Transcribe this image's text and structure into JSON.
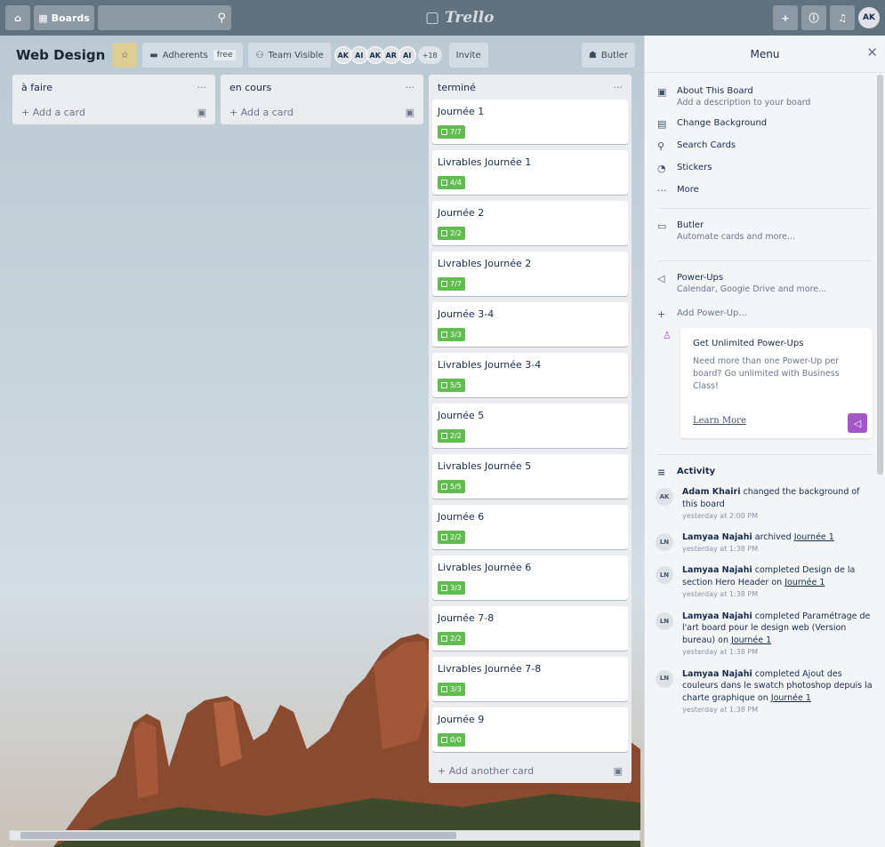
{
  "nav": {
    "boards_label": "Boards",
    "logo": "Trello",
    "avatar": "AK"
  },
  "board": {
    "title": "Web Design",
    "adherents_label": "Adherents",
    "adherents_tag": "free",
    "visibility_label": "Team Visible",
    "members": [
      "AK",
      "AI",
      "AK",
      "AR",
      "AI"
    ],
    "members_more": "+18",
    "invite_label": "Invite",
    "butler_label": "Butler"
  },
  "lists": [
    {
      "title": "à faire",
      "add_label": "+ Add a card",
      "cards": []
    },
    {
      "title": "en cours",
      "add_label": "+ Add a card",
      "cards": []
    },
    {
      "title": "terminé",
      "add_label": "+ Add another card",
      "cards": [
        {
          "title": "Journée 1",
          "badge": "7/7"
        },
        {
          "title": "Livrables Journée 1",
          "badge": "4/4"
        },
        {
          "title": "Journée 2",
          "badge": "2/2"
        },
        {
          "title": "Livrables Journée 2",
          "badge": "7/7"
        },
        {
          "title": "Journée 3-4",
          "badge": "3/3"
        },
        {
          "title": "Livrables Journée 3-4",
          "badge": "5/5"
        },
        {
          "title": "Journée 5",
          "badge": "2/2"
        },
        {
          "title": "Livrables Journée 5",
          "badge": "5/5"
        },
        {
          "title": "Journée 6",
          "badge": "2/2"
        },
        {
          "title": "Livrables Journée 6",
          "badge": "3/3"
        },
        {
          "title": "Journée 7-8",
          "badge": "2/2"
        },
        {
          "title": "Livrables Journée 7-8",
          "badge": "3/3"
        },
        {
          "title": "Journée 9",
          "badge": "0/0"
        }
      ]
    }
  ],
  "menu": {
    "title": "Menu",
    "about_title": "About This Board",
    "about_sub": "Add a description to your board",
    "change_bg": "Change Background",
    "search_cards": "Search Cards",
    "stickers": "Stickers",
    "more": "More",
    "butler_title": "Butler",
    "butler_sub": "Automate cards and more...",
    "powerups_title": "Power-Ups",
    "powerups_sub": "Calendar, Google Drive and more...",
    "add_powerup": "Add Power-Up...",
    "unlimited_title": "Get Unlimited Power-Ups",
    "unlimited_text": "Need more than one Power-Up per board? Go unlimited with Business Class!",
    "learn_more": "Learn More",
    "activity_title": "Activity",
    "activity": [
      {
        "avatar": "AK",
        "user": "Adam Khairi",
        "text": " changed the background of this board",
        "link": "",
        "time": "yesterday at 2:00 PM"
      },
      {
        "avatar": "LN",
        "user": "Lamyaa Najahi",
        "text": " archived ",
        "link": "Journée 1",
        "time": "yesterday at 1:38 PM"
      },
      {
        "avatar": "LN",
        "user": "Lamyaa Najahi",
        "text": " completed Design de la section Hero Header on ",
        "link": "Journée 1",
        "time": "yesterday at 1:38 PM"
      },
      {
        "avatar": "LN",
        "user": "Lamyaa Najahi",
        "text": " completed Paramétrage de l'art board pour le design web (Version bureau) on ",
        "link": "Journée 1",
        "time": "yesterday at 1:38 PM"
      },
      {
        "avatar": "LN",
        "user": "Lamyaa Najahi",
        "text": " completed Ajout des couleurs dans le swatch photoshop depuis la charte graphique on ",
        "link": "Journée 1",
        "time": "yesterday at 1:38 PM"
      }
    ]
  }
}
